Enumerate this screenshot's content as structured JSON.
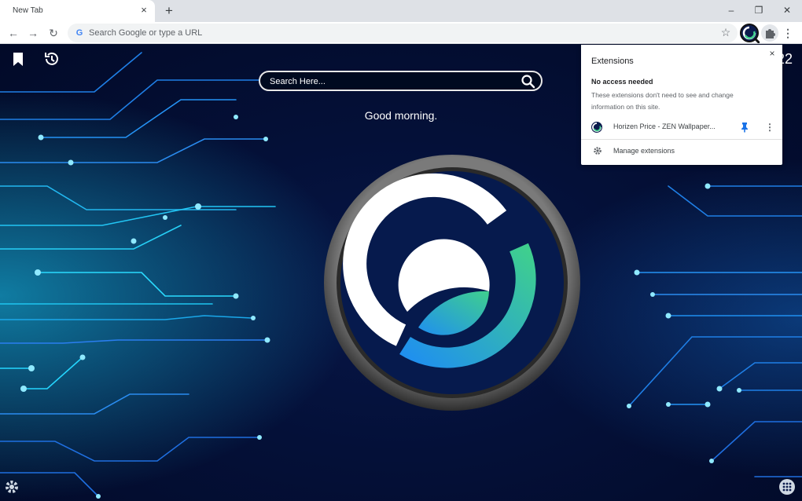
{
  "tab": {
    "title": "New Tab",
    "close": "×",
    "new_tab": "+"
  },
  "window": {
    "minimize": "–",
    "restore": "❐",
    "close": "✕"
  },
  "toolbar": {
    "back": "←",
    "forward": "→",
    "reload": "↻",
    "omnibox_placeholder": "Search Google or type a URL",
    "google_glyph": "G",
    "star": "☆",
    "menu": "⋮"
  },
  "page": {
    "search_placeholder": "Search Here...",
    "greeting": "Good morning.",
    "clock_partial": "22"
  },
  "extensions_popup": {
    "title": "Extensions",
    "close": "×",
    "section_title": "No access needed",
    "section_desc": "These extensions don't need to see and change information on this site.",
    "extensions": [
      {
        "name": "Horizen Price - ZEN Wallpaper..."
      }
    ],
    "more": "⋮",
    "manage_label": "Manage extensions"
  },
  "colors": {
    "accent_cyan": "#19d3f5",
    "logo_green": "#3fcf8e",
    "logo_blue": "#1f8ff0",
    "pin_blue": "#1a73e8"
  },
  "icons": [
    "bookmark-icon",
    "history-icon",
    "search-icon",
    "settings-gear-icon",
    "apps-grid-icon",
    "puzzle-icon",
    "pin-icon"
  ]
}
